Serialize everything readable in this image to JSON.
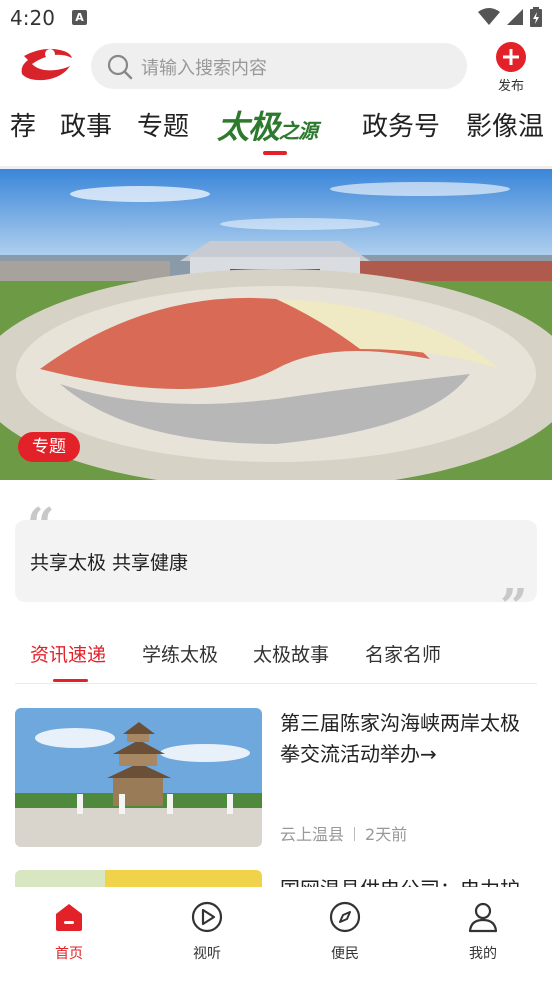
{
  "status_bar": {
    "time": "4:20",
    "notification_glyph": "A"
  },
  "header": {
    "search_placeholder": "请输入搜索内容",
    "publish_label": "发布"
  },
  "channels": {
    "items": [
      {
        "label": "荐"
      },
      {
        "label": "政事"
      },
      {
        "label": "专题"
      },
      {
        "label": "太极",
        "label_suffix": "之源",
        "active": true
      },
      {
        "label": "政务号"
      },
      {
        "label": "影像温"
      }
    ]
  },
  "banner": {
    "tag": "专题"
  },
  "quote": {
    "text": "共享太极 共享健康",
    "open_mark": "“",
    "close_mark": "”"
  },
  "subtabs": {
    "items": [
      {
        "label": "资讯速递",
        "active": true
      },
      {
        "label": "学练太极"
      },
      {
        "label": "太极故事"
      },
      {
        "label": "名家名师"
      }
    ]
  },
  "news": [
    {
      "title": "第三届陈家沟海峡两岸太极拳交流活动举办→",
      "source": "云上温县",
      "time": "2天前"
    },
    {
      "title": "国网温县供电公司：电力护"
    }
  ],
  "bottom_nav": {
    "items": [
      {
        "label": "首页",
        "icon": "home-icon",
        "active": true
      },
      {
        "label": "视听",
        "icon": "play-icon"
      },
      {
        "label": "便民",
        "icon": "compass-icon"
      },
      {
        "label": "我的",
        "icon": "user-icon"
      }
    ]
  },
  "colors": {
    "accent": "#e32129",
    "brand_green": "#2d7a2e",
    "muted_text": "#999999"
  }
}
